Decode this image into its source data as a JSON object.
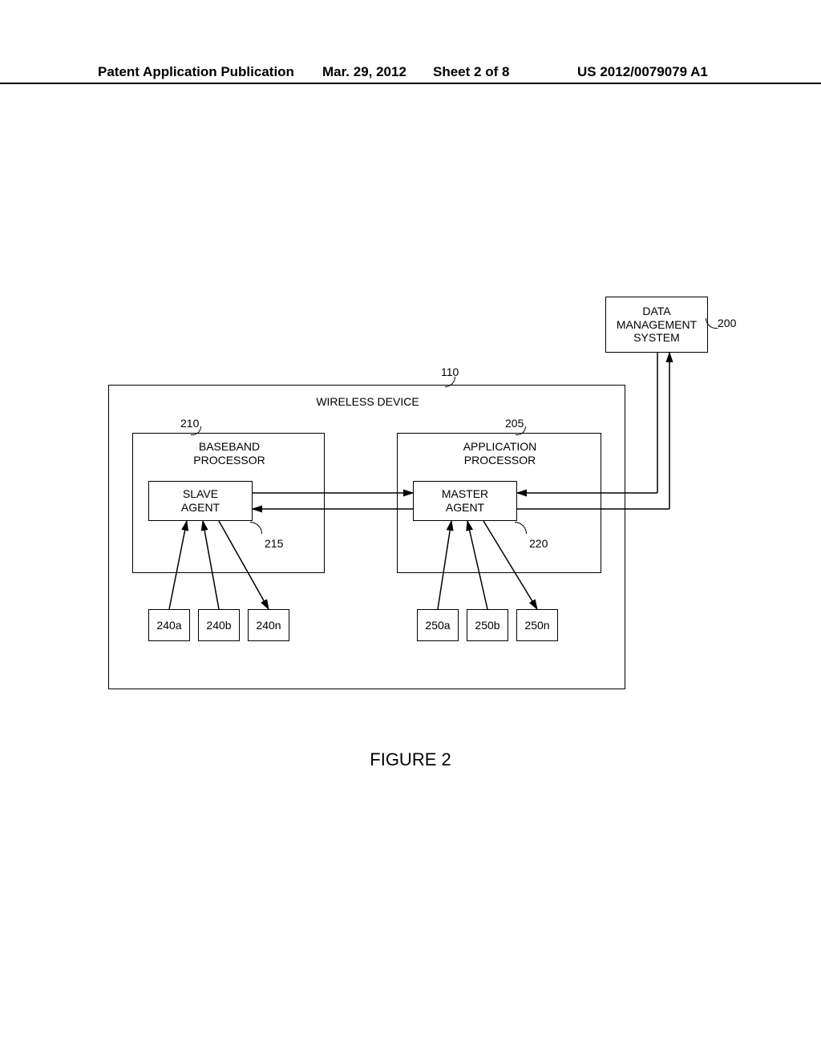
{
  "header": {
    "left": "Patent Application Publication",
    "date": "Mar. 29, 2012",
    "sheet": "Sheet 2 of 8",
    "pubno": "US 2012/0079079 A1"
  },
  "figure_caption": "FIGURE 2",
  "data_mgmt": {
    "label": "DATA\nMANAGEMENT\nSYSTEM",
    "ref": "200"
  },
  "wireless": {
    "label": "WIRELESS DEVICE",
    "ref": "110"
  },
  "baseband": {
    "label": "BASEBAND\nPROCESSOR",
    "ref": "210"
  },
  "application": {
    "label": "APPLICATION\nPROCESSOR",
    "ref": "205"
  },
  "slave": {
    "label": "SLAVE\nAGENT",
    "ref": "215"
  },
  "master": {
    "label": "MASTER\nAGENT",
    "ref": "220"
  },
  "slave_children": {
    "a": "240a",
    "b": "240b",
    "n": "240n"
  },
  "master_children": {
    "a": "250a",
    "b": "250b",
    "n": "250n"
  }
}
